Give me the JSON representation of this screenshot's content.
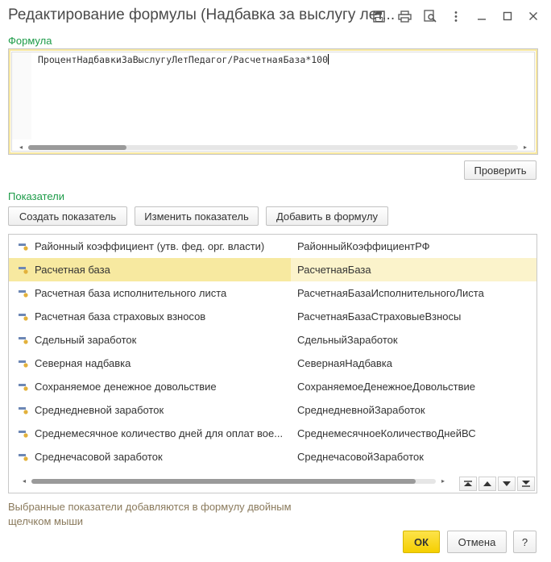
{
  "window": {
    "title": "Редактирование формулы (Надбавка за выслугу лет...",
    "icons": [
      "save-icon",
      "print-icon",
      "preview-icon",
      "more-icon",
      "minimize-icon",
      "maximize-icon",
      "close-icon"
    ]
  },
  "formula": {
    "label": "Формула",
    "text": "ПроцентНадбавкиЗаВыслугуЛетПедагог/РасчетнаяБаза*100",
    "scroll_position": 0.2
  },
  "check_button": "Проверить",
  "indicators": {
    "label": "Показатели",
    "buttons": {
      "create": "Создать показатель",
      "edit": "Изменить показатель",
      "add": "Добавить в формулу"
    },
    "rows": [
      {
        "name": "Районный коэффициент (утв. фед. орг. власти)",
        "id": "РайонныйКоэффициентРФ",
        "selected": false
      },
      {
        "name": "Расчетная база",
        "id": "РасчетнаяБаза",
        "selected": true
      },
      {
        "name": "Расчетная база исполнительного листа",
        "id": "РасчетнаяБазаИсполнительногоЛиста",
        "selected": false
      },
      {
        "name": "Расчетная база страховых взносов",
        "id": "РасчетнаяБазаСтраховыеВзносы",
        "selected": false
      },
      {
        "name": "Сдельный заработок",
        "id": "СдельныйЗаработок",
        "selected": false
      },
      {
        "name": "Северная надбавка",
        "id": "СевернаяНадбавка",
        "selected": false
      },
      {
        "name": "Сохраняемое денежное довольствие",
        "id": "СохраняемоеДенежноеДовольствие",
        "selected": false
      },
      {
        "name": "Среднедневной заработок",
        "id": "СреднедневнойЗаработок",
        "selected": false
      },
      {
        "name": "Среднемесячное количество дней для оплат вое...",
        "id": "СреднемесячноеКоличествоДнейВС",
        "selected": false
      },
      {
        "name": "Среднечасовой заработок",
        "id": "СреднечасовойЗаработок",
        "selected": false
      }
    ],
    "list_scroll_position": 0.95
  },
  "hint": "Выбранные показатели добавляются в формулу двойным щелчком мыши",
  "footer": {
    "ok": "ОК",
    "cancel": "Отмена",
    "help": "?"
  },
  "colors": {
    "accent_green": "#1c9b48",
    "selection": "#f7e9a0",
    "ok_button": "#f5cf00"
  }
}
